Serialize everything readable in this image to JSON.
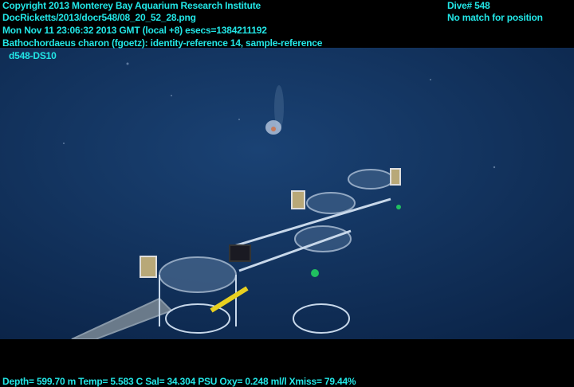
{
  "overlay": {
    "copyright": "Copyright 2013 Monterey Bay Aquarium Research Institute",
    "file_path": "DocRicketts/2013/docr548/08_20_52_28.png",
    "timestamp": "Mon Nov 11 23:06:32 2013 GMT (local +8)  esecs=1384211192",
    "annotation": "Bathochordaeus charon (fgoetz): identity-reference 14, sample-reference",
    "annotation_cont": "d548-DS10",
    "dive": "Dive# 548",
    "position": "No match for position",
    "sensors": "Depth= 599.70 m  Temp= 5.583 C  Sal= 34.304 PSU  Oxy= 0.248 ml/l  Xmiss= 79.44%"
  },
  "colors": {
    "overlay_text": "#22e6e6",
    "water": "#10305a"
  }
}
